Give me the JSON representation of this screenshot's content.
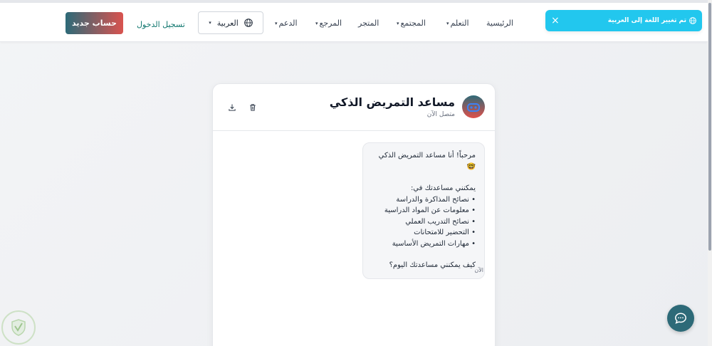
{
  "toast": {
    "message": "تم تغيير اللغة إلى العربية"
  },
  "nav": {
    "home": "الرئيسية",
    "learn": "التعلم",
    "community": "المجتمع",
    "store": "المتجر",
    "reference": "المرجع",
    "support": "الدعم",
    "language": "العربية",
    "login": "تسجيل الدخول",
    "signup": "حساب جديد"
  },
  "chat": {
    "title": "مساعد التمريض الذكي",
    "status": "متصل الآن",
    "message": {
      "greeting": "مرحباً! أنا مساعد التمريض الذكي 🤓",
      "intro": "يمكنني مساعدتك في:",
      "items": [
        "نصائح المذاكرة والدراسة",
        "معلومات عن المواد الدراسية",
        "نصائح التدريب العملي",
        "التحضير للامتحانات",
        "مهارات التمريض الأساسية"
      ],
      "question": "كيف يمكنني مساعدتك اليوم؟"
    },
    "time": "الآن"
  },
  "colors": {
    "primary": "#2d6a78",
    "accent": "#d9534f",
    "toast": "#22c7ee"
  }
}
